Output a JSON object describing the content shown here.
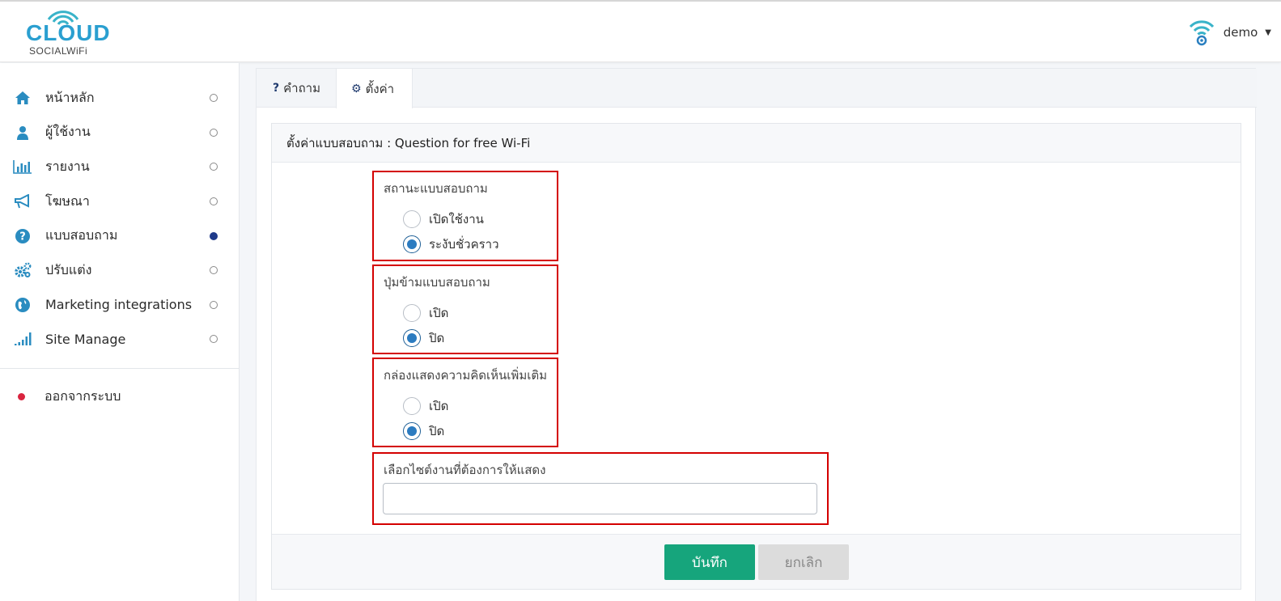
{
  "brand": {
    "name": "CLOUD",
    "sub": "SOCIALWiFi"
  },
  "user": {
    "name": "demo"
  },
  "sidebar": {
    "items": [
      {
        "label": "หน้าหลัก",
        "icon": "home-icon",
        "active": false
      },
      {
        "label": "ผู้ใช้งาน",
        "icon": "user-icon",
        "active": false
      },
      {
        "label": "รายงาน",
        "icon": "bar-chart-icon",
        "active": false
      },
      {
        "label": "โฆษณา",
        "icon": "megaphone-icon",
        "active": false
      },
      {
        "label": "แบบสอบถาม",
        "icon": "question-circle-icon",
        "active": true
      },
      {
        "label": "ปรับแต่ง",
        "icon": "gears-icon",
        "active": false
      },
      {
        "label": "Marketing integrations",
        "icon": "globe-icon",
        "active": false
      },
      {
        "label": "Site Manage",
        "icon": "signal-bars-icon",
        "active": false
      }
    ],
    "logout": "ออกจากระบบ"
  },
  "tabs": [
    {
      "icon": "?",
      "label": "คำถาม"
    },
    {
      "icon": "⚙",
      "label": "ตั้งค่า"
    }
  ],
  "panel": {
    "title": "ตั้งค่าแบบสอบถาม : Question for free Wi-Fi",
    "status": {
      "title": "สถานะแบบสอบถาม",
      "options": [
        "เปิดใช้งาน",
        "ระงับชั่วคราว"
      ],
      "selected": 1
    },
    "skip": {
      "title": "ปุ่มข้ามแบบสอบถาม",
      "options": [
        "เปิด",
        "ปิด"
      ],
      "selected": 1
    },
    "comment": {
      "title": "กล่องแสดงความคิดเห็นเพิ่มเติม",
      "options": [
        "เปิด",
        "ปิด"
      ],
      "selected": 1
    },
    "site": {
      "title": "เลือกไซต์งานที่ต้องการให้แสดง",
      "value": ""
    },
    "save_label": "บันทึก",
    "cancel_label": "ยกเลิก"
  },
  "colors": {
    "accent": "#2a9fd0",
    "save": "#16a57c",
    "highlight": "#d40000",
    "active_dot": "#1f3a8a"
  }
}
